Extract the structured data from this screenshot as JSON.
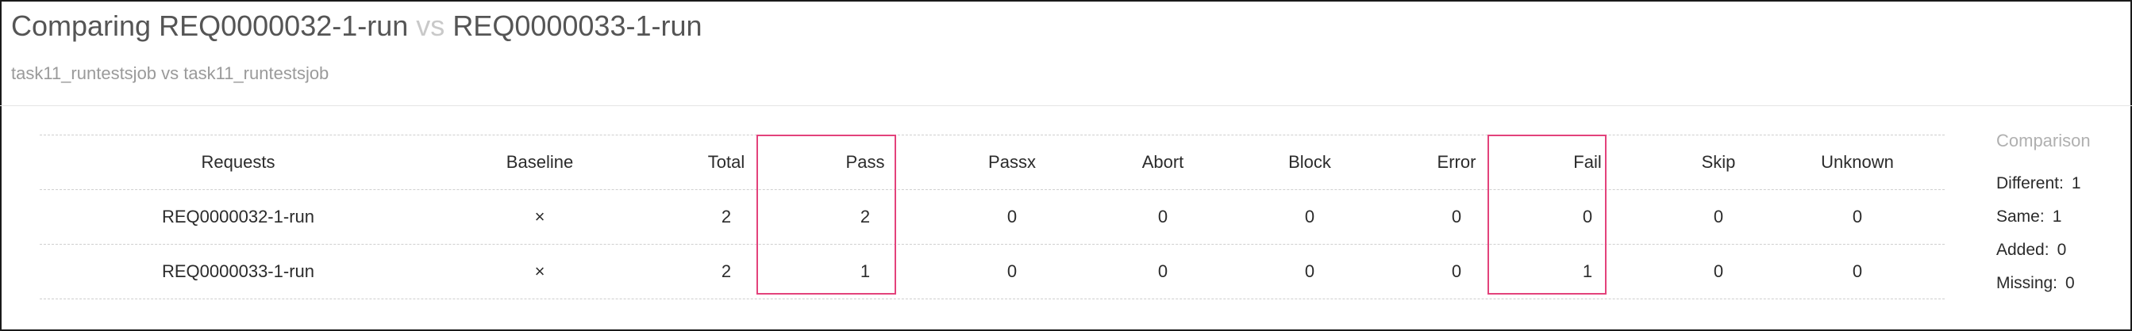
{
  "header": {
    "title_left": "Comparing REQ0000032-1-run",
    "title_vs": "vs",
    "title_right": "REQ0000033-1-run",
    "subtitle": "task11_runtestsjob vs task11_runtestsjob"
  },
  "table": {
    "columns": [
      "Requests",
      "Baseline",
      "Total",
      "Pass",
      "Passx",
      "Abort",
      "Block",
      "Error",
      "Fail",
      "Skip",
      "Unknown"
    ],
    "rows": [
      [
        "REQ0000032-1-run",
        "×",
        "2",
        "2",
        "0",
        "0",
        "0",
        "0",
        "0",
        "0",
        "0"
      ],
      [
        "REQ0000033-1-run",
        "×",
        "2",
        "1",
        "0",
        "0",
        "0",
        "0",
        "1",
        "0",
        "0"
      ]
    ],
    "highlight_color": "#e3427b"
  },
  "comparison": {
    "heading": "Comparison",
    "items": [
      {
        "label": "Different:",
        "value": "1"
      },
      {
        "label": "Same:",
        "value": "1"
      },
      {
        "label": "Added:",
        "value": "0"
      },
      {
        "label": "Missing:",
        "value": "0"
      }
    ]
  }
}
